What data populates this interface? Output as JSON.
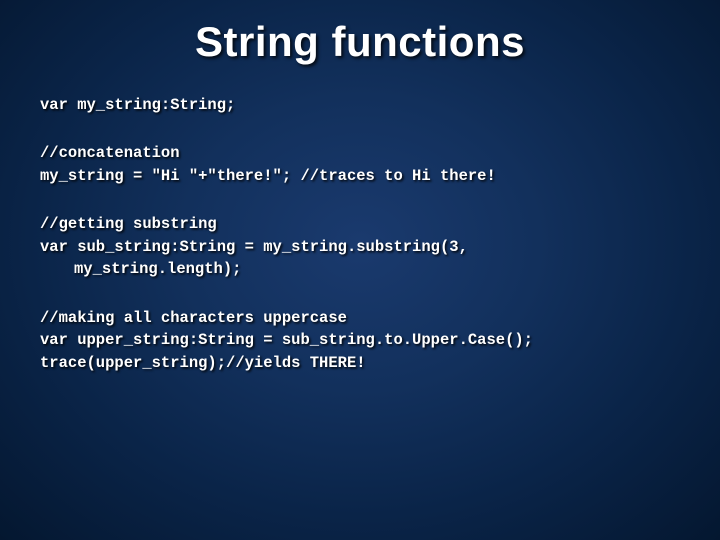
{
  "slide": {
    "title": "String functions",
    "blocks": [
      {
        "lines": [
          "var my_string:String;"
        ]
      },
      {
        "lines": [
          "//concatenation",
          "my_string = \"Hi \"+\"there!\"; //traces to Hi there!"
        ]
      },
      {
        "lines": [
          "//getting substring",
          "var sub_string:String = my_string.substring(3,"
        ],
        "indent_line": "my_string.length);"
      },
      {
        "lines": [
          "//making all characters uppercase",
          "var upper_string:String = sub_string.to.Upper.Case();",
          "trace(upper_string);//yields THERE!"
        ]
      }
    ]
  }
}
